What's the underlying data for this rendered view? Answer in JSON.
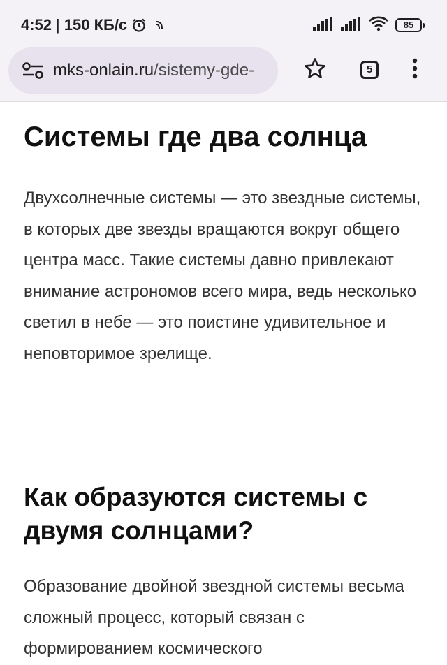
{
  "status_bar": {
    "time": "4:52",
    "separator": "|",
    "speed": "150 КБ/с",
    "battery": "85",
    "icons": [
      "alarm-icon",
      "nfc-icon",
      "signal-icon",
      "signal-icon",
      "wifi-icon",
      "battery-icon"
    ]
  },
  "browser": {
    "url_domain": "mks-onlain.ru",
    "url_path": "/sistemy-gde-",
    "tab_count": "5",
    "icons": [
      "site-settings-icon",
      "star-icon",
      "tabs-icon",
      "more-vert-icon"
    ]
  },
  "article": {
    "title": "Системы где два солнца",
    "intro": "Двухсолнечные системы — это звездные системы, в которых две звезды вращаются вокруг общего центра масс. Такие системы давно привлекают внимание астрономов всего мира, ведь несколько светил в небе — это поистине удивительное и неповторимое зрелище.",
    "section_heading": "Как образуются системы с двумя солнцами?",
    "section_text": "Образование двойной звездной системы весьма сложный процесс, который связан с формированием космического"
  },
  "colors": {
    "chrome_bg": "#f4f1f7",
    "url_bar_bg": "#e7e2ee",
    "heading": "#111111",
    "body_text": "#333333"
  }
}
